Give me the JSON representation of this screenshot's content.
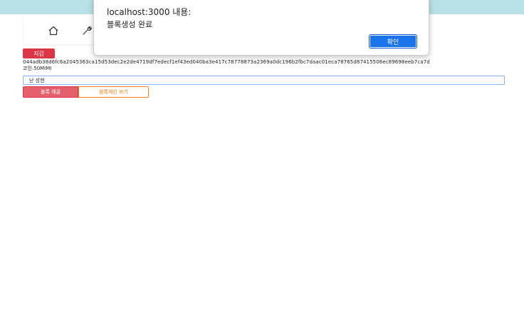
{
  "alert": {
    "title": "localhost:3000 내용:",
    "message": "블록생성 완료",
    "ok_label": "확인"
  },
  "nav": {
    "icons": [
      "house-icon",
      "wrench-icon"
    ]
  },
  "wallet": {
    "badge_label": "지갑",
    "address": "044adb38d6fc6a2045363ca15d53dec2e2de4719df7edecf1ef43ed040ba3e417c78778873a2369a0dc196b2fbc7daac01eca78765d87415506ec89698eeb7ca7d",
    "coin_text": "코인:50MIMI"
  },
  "block_form": {
    "input_value": "난 성현",
    "create_label": "블록 채굴",
    "view_label": "블록체인 보기"
  },
  "colors": {
    "topbar": "#b7e1e5",
    "danger": "#dc3545",
    "warning": "#fd7e14",
    "primary": "#1a73e8"
  }
}
